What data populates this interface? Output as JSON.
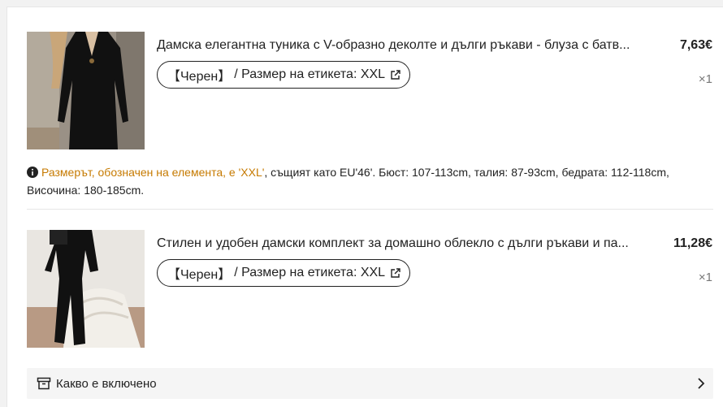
{
  "items": [
    {
      "title": "Дамска елегантна туника с V-образно деколте и дълги ръкави - блуза с батв...",
      "price": "7,63€",
      "variant": {
        "color": "【Черен】",
        "size_label": "/ Размер на етикета: XXL"
      },
      "quantity": "×1"
    },
    {
      "title": "Стилен и удобен дамски комплект за домашно облекло с дълги ръкави и па...",
      "price": "11,28€",
      "variant": {
        "color": "【Черен】",
        "size_label": "/ Размер на етикета: XXL"
      },
      "quantity": "×1"
    }
  ],
  "size_note": {
    "highlight": "Размерът, обозначен на елемента, е 'XXL'",
    "rest": ", същият като EU'46'. Бюст: 107-113cm, талия: 87-93cm, бедрата: 112-118cm, Височина: 180-185cm."
  },
  "included": {
    "label": "Какво е включено"
  },
  "icons": {
    "info": "info-icon",
    "edit": "external-edit-icon",
    "box": "archive-box-icon",
    "chevron": "chevron-right-icon"
  },
  "colors": {
    "accent_note": "#c67a00",
    "text": "#222222",
    "muted": "#777777"
  }
}
